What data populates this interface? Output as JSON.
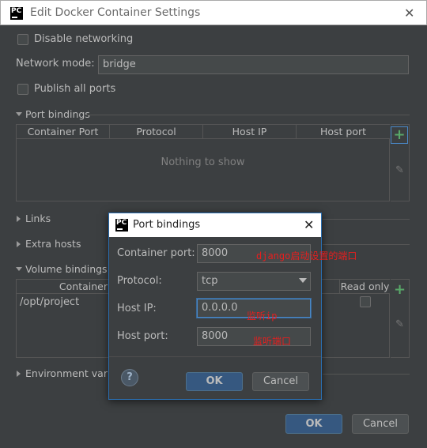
{
  "window": {
    "title": "Edit Docker Container Settings",
    "close_glyph": "✕"
  },
  "settings": {
    "disable_networking_label": "Disable networking",
    "network_mode_label": "Network mode:",
    "network_mode_value": "bridge",
    "publish_all_ports_label": "Publish all ports"
  },
  "port_bindings": {
    "section_label": "Port bindings",
    "columns": [
      "Container Port",
      "Protocol",
      "Host IP",
      "Host port"
    ],
    "empty_text": "Nothing to show"
  },
  "sections": {
    "links": "Links",
    "extra_hosts": "Extra hosts",
    "volume_bindings": "Volume bindings",
    "environment_variables": "Environment variabl"
  },
  "volume_bindings": {
    "col_container": "Container",
    "col_read_only": "Read only",
    "rows": [
      {
        "container": "/opt/project"
      }
    ]
  },
  "buttons": {
    "ok": "OK",
    "cancel": "Cancel",
    "plus": "+",
    "pencil": "✎"
  },
  "dialog": {
    "title": "Port bindings",
    "logo_text": "PC",
    "close_glyph": "✕",
    "container_port_label": "Container port:",
    "container_port_value": "8000",
    "container_port_note": "django启动设置的端口",
    "protocol_label": "Protocol:",
    "protocol_value": "tcp",
    "host_ip_label": "Host IP:",
    "host_ip_value": "0.0.0.0",
    "host_ip_note": "监听ip",
    "host_port_label": "Host port:",
    "host_port_value": "8000",
    "host_port_note": "监听端口",
    "help_glyph": "?",
    "ok": "OK",
    "cancel": "Cancel"
  },
  "colors": {
    "background": "#3c3f41",
    "accent_button": "#365880",
    "annotation_red": "#e81e1e",
    "plus_green": "#59a869"
  }
}
